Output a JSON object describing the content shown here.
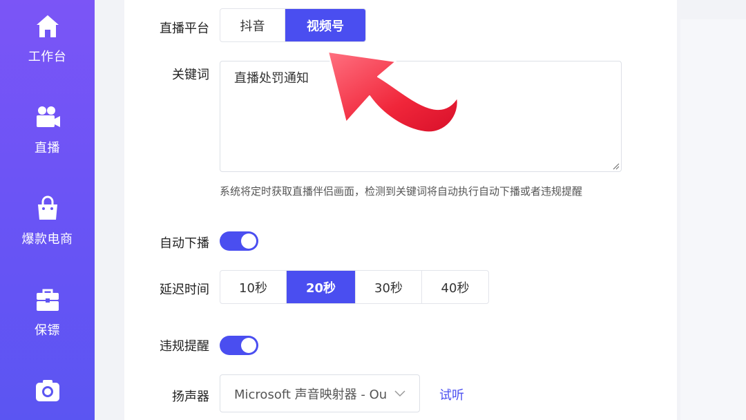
{
  "sidebar": {
    "items": [
      {
        "label": "工作台",
        "icon": "home-icon"
      },
      {
        "label": "直播",
        "icon": "video-camera-icon"
      },
      {
        "label": "爆款电商",
        "icon": "shopping-bag-icon"
      },
      {
        "label": "保镖",
        "icon": "briefcase-icon"
      },
      {
        "label": "",
        "icon": "camera-icon"
      }
    ],
    "gradient_top": "#7b55f6",
    "gradient_bottom": "#5b55f2"
  },
  "form": {
    "platform": {
      "label": "直播平台",
      "options": [
        "抖音",
        "视频号"
      ],
      "selected": "视频号"
    },
    "keyword": {
      "label": "关键词",
      "value": "直播处罚通知",
      "hint": "系统将定时获取直播伴侣画面，检测到关键词将自动执行自动下播或者违规提醒"
    },
    "auto_offline": {
      "label": "自动下播",
      "enabled": true
    },
    "delay": {
      "label": "延迟时间",
      "options": [
        "10秒",
        "20秒",
        "30秒",
        "40秒"
      ],
      "selected": "20秒"
    },
    "violation_alert": {
      "label": "违规提醒",
      "enabled": true
    },
    "speaker": {
      "label": "扬声器",
      "value": "Microsoft 声音映射器 - Ou",
      "preview_label": "试听"
    }
  },
  "colors": {
    "accent": "#4a4ef0",
    "arrow": "#f0263a"
  }
}
